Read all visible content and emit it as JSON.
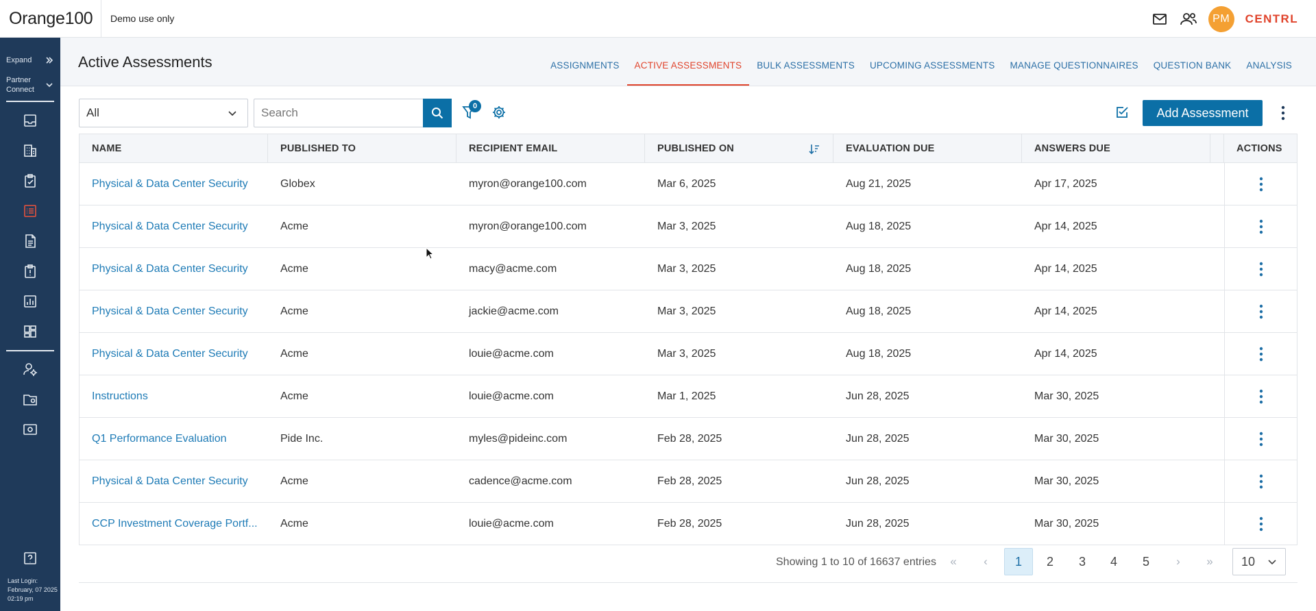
{
  "app": {
    "brand": "Orange100",
    "demo_label": "Demo use only",
    "company": "CENTRL",
    "user_initials": "PM"
  },
  "colors": {
    "accent": "#0b6fa6",
    "active_tab": "#e0432b",
    "sidebar_bg": "#1f3a5a",
    "avatar": "#f4a033",
    "link": "#1e7bb6"
  },
  "topbar": {
    "icons": [
      "mail-icon",
      "users-icon"
    ]
  },
  "sidebar": {
    "expand_label": "Expand",
    "partner_label_line1": "Partner",
    "partner_label_line2": "Connect",
    "icons": [
      "inbox-icon",
      "building-icon",
      "clipboard-check-icon",
      "list-icon",
      "document-icon",
      "clipboard-alert-icon",
      "report-icon",
      "dashboard-icon",
      "user-settings-icon",
      "folder-settings-icon",
      "screen-settings-icon",
      "help-icon"
    ],
    "active_icon": "list-icon",
    "last_login_label": "Last Login:",
    "last_login_date": "February, 07 2025",
    "last_login_time": "02:19 pm"
  },
  "page": {
    "title": "Active Assessments",
    "tabs": [
      {
        "label": "ASSIGNMENTS",
        "active": false
      },
      {
        "label": "ACTIVE ASSESSMENTS",
        "active": true
      },
      {
        "label": "BULK ASSESSMENTS",
        "active": false
      },
      {
        "label": "UPCOMING ASSESSMENTS",
        "active": false
      },
      {
        "label": "MANAGE QUESTIONNAIRES",
        "active": false
      },
      {
        "label": "QUESTION BANK",
        "active": false
      },
      {
        "label": "ANALYSIS",
        "active": false
      }
    ]
  },
  "toolbar": {
    "filter_select_value": "All",
    "search_placeholder": "Search",
    "filter_count": "0",
    "add_button_label": "Add Assessment"
  },
  "table": {
    "columns": [
      "NAME",
      "PUBLISHED TO",
      "RECIPIENT EMAIL",
      "PUBLISHED ON",
      "EVALUATION DUE",
      "ANSWERS DUE",
      "ACTIONS"
    ],
    "sorted_column": "PUBLISHED ON",
    "rows": [
      {
        "name": "Physical & Data Center Security",
        "published_to": "Globex",
        "email": "myron@orange100.com",
        "published_on": "Mar 6, 2025",
        "evaluation_due": "Aug 21, 2025",
        "answers_due": "Apr 17, 2025"
      },
      {
        "name": "Physical & Data Center Security",
        "published_to": "Acme",
        "email": "myron@orange100.com",
        "published_on": "Mar 3, 2025",
        "evaluation_due": "Aug 18, 2025",
        "answers_due": "Apr 14, 2025"
      },
      {
        "name": "Physical & Data Center Security",
        "published_to": "Acme",
        "email": "macy@acme.com",
        "published_on": "Mar 3, 2025",
        "evaluation_due": "Aug 18, 2025",
        "answers_due": "Apr 14, 2025"
      },
      {
        "name": "Physical & Data Center Security",
        "published_to": "Acme",
        "email": "jackie@acme.com",
        "published_on": "Mar 3, 2025",
        "evaluation_due": "Aug 18, 2025",
        "answers_due": "Apr 14, 2025"
      },
      {
        "name": "Physical & Data Center Security",
        "published_to": "Acme",
        "email": "louie@acme.com",
        "published_on": "Mar 3, 2025",
        "evaluation_due": "Aug 18, 2025",
        "answers_due": "Apr 14, 2025"
      },
      {
        "name": "Instructions",
        "published_to": "Acme",
        "email": "louie@acme.com",
        "published_on": "Mar 1, 2025",
        "evaluation_due": "Jun 28, 2025",
        "answers_due": "Mar 30, 2025"
      },
      {
        "name": "Q1 Performance Evaluation",
        "published_to": "Pide Inc.",
        "email": "myles@pideinc.com",
        "published_on": "Feb 28, 2025",
        "evaluation_due": "Jun 28, 2025",
        "answers_due": "Mar 30, 2025"
      },
      {
        "name": "Physical & Data Center Security",
        "published_to": "Acme",
        "email": "cadence@acme.com",
        "published_on": "Feb 28, 2025",
        "evaluation_due": "Jun 28, 2025",
        "answers_due": "Mar 30, 2025"
      },
      {
        "name": "CCP Investment Coverage Portf...",
        "published_to": "Acme",
        "email": "louie@acme.com",
        "published_on": "Feb 28, 2025",
        "evaluation_due": "Jun 28, 2025",
        "answers_due": "Mar 30, 2025"
      }
    ]
  },
  "pagination": {
    "summary": "Showing 1 to 10 of 16637 entries",
    "first": "«",
    "prev": "‹",
    "next": "›",
    "last": "»",
    "pages": [
      "1",
      "2",
      "3",
      "4",
      "5"
    ],
    "current_page": "1",
    "page_size": "10"
  }
}
